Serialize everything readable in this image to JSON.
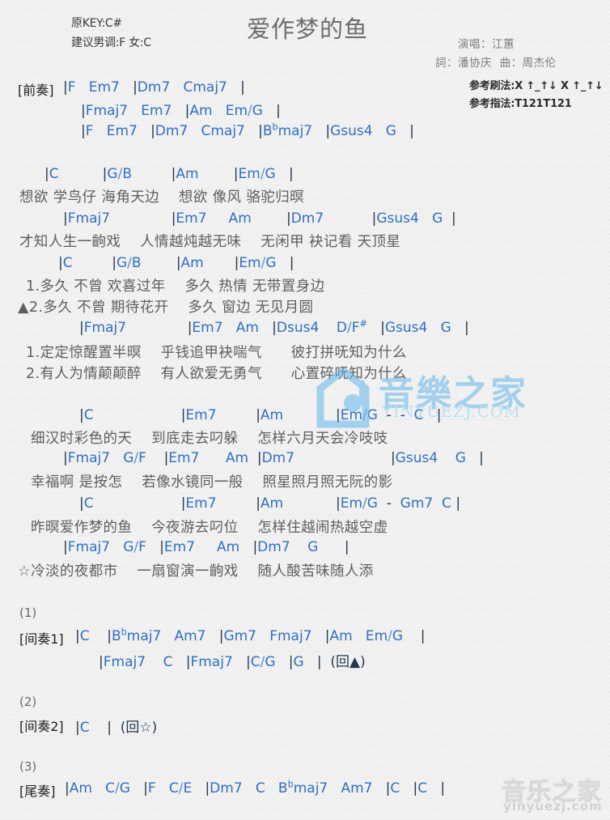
{
  "page": {
    "background_color": "#f3f3f3",
    "chord_color": "#2f6fc4",
    "lyric_color": "#5e5e5e",
    "title_color": "#6d6d6d"
  },
  "header": {
    "original_key": "原KEY:C#",
    "suggested_key": "建议男调:F 女:C",
    "title": "爱作梦的鱼",
    "singer": "演唱：江蕙",
    "writer": "詞：潘协庆  曲：周杰伦",
    "strum_pattern": "参考刷法:X ↑_↑↓ X ↑_↑↓",
    "finger_pattern": "参考指法:T121T121"
  },
  "sections": {
    "intro_label": "[前奏]",
    "interlude1_label": "[间奏1]",
    "interlude2_label": "[间奏2]",
    "outro_label": "[尾奏]",
    "num1": "(1)",
    "num2": "(2)",
    "num3": "(3)"
  },
  "lines": {
    "intro1": "|F   Em7   |Dm7   Cmaj7   |",
    "intro2": "|Fmaj7   Em7   |Am   Em/G   |",
    "intro3": "|F   Em7   |Dm7   Cmaj7   |B♭maj7   |Gsus4   G   |",
    "v1_chord1": "|C          |G/B         |Am        |Em/G   |",
    "v1_lyric1": "想欲 学鸟仔 海角天边    想欲 像风 骆驼归暝",
    "v1_chord2": "|Fmaj7              |Em7     Am        |Dm7           |Gsus4   G  |",
    "v1_lyric2": "才知人生一齣戏    人情越炖越无味    无闲甲 袂记看 天顶星",
    "v2_chord1": "|C         |G/B        |Am       |Em/G   |",
    "v2_lyric1": "1.多久 不曾 欢喜过年    多久 热情 无带置身边",
    "v2_lyric2": "▲2.多久 不曾 期待花开    多久 窗边 无见月圆",
    "v2_chord2": "|Fmaj7              |Em7   Am   |Dsus4    D/F#   |Gsus4   G   |",
    "v2_lyric3": "1.定定惊醒置半暝    乎钱追甲袂喘气      彼打拼呒知为什么",
    "v2_lyric4": "2.有人为情颠颠醉    有人欲爱无勇气      心置碎呒知为什么",
    "c1_chord1": "|C                    |Em7         |Am            |Em/G  -  -  C   |",
    "c1_lyric1": "细汉时彩色的天    到底走去叼躲    怎样六月天会冷吱吱",
    "c1_chord2": "|Fmaj7   G/F    |Em7      Am  |Dm7                      |Gsus4    G   |",
    "c1_lyric2": "幸福啊 是按怎    若像水镜同一般    照星照月照无阮的影",
    "c2_chord1": "|C                    |Em7         |Am            |Em/G  -  Gm7  C |",
    "c2_lyric1": "昨暝爱作梦的鱼    今夜游去叼位    怎样住越闹热越空虚",
    "c2_chord2": "|Fmaj7   G/F   |Em7     Am   |Dm7    G      |",
    "c2_lyric2": "☆冷淡的夜都市    一扇窗演一齣戏    随人酸苦味随人添",
    "int1_line1": "|C    |B♭maj7   Am7   |Gm7   Fmaj7   |Am   Em/G    |",
    "int1_line2": "|Fmaj7    C   |Fmaj7   |C/G   |G   |  (回▲)",
    "int2_line1": "|C    |  (回☆)",
    "outro_line1": "|Am   C/G   |F   C/E   |Dm7   C   B♭maj7   Am7   |C   |C   |"
  },
  "watermarks": {
    "center_text": "音樂之家",
    "center_url": "YINYUEZJ.COM",
    "bottom_text": "音乐之家",
    "bottom_url": "yinyuezj.com"
  }
}
